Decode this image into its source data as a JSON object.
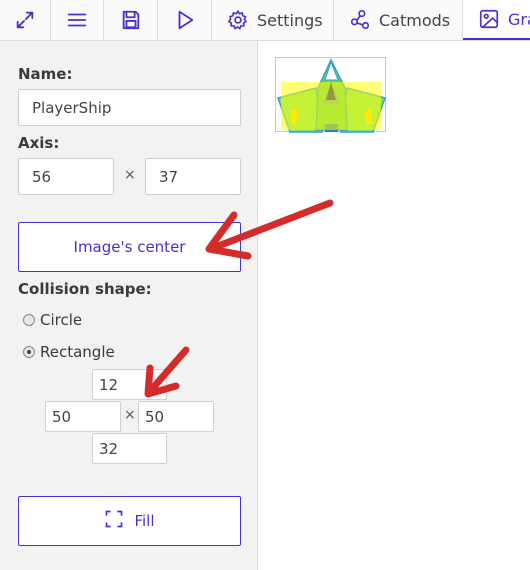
{
  "toolbar": {
    "buttons": [
      {
        "name": "expand",
        "icon": "expand-icon"
      },
      {
        "name": "menu",
        "icon": "menu-icon"
      },
      {
        "name": "save",
        "icon": "save-icon"
      },
      {
        "name": "play",
        "icon": "play-icon"
      }
    ],
    "tabs": [
      {
        "label": "Settings",
        "icon": "gear-icon"
      },
      {
        "label": "Catmods",
        "icon": "share-icon"
      },
      {
        "label": "Gra",
        "icon": "image-icon",
        "active": true
      }
    ]
  },
  "sidebar": {
    "name_label": "Name:",
    "name_value": "PlayerShip",
    "axis_label": "Axis:",
    "axis_x": "56",
    "axis_y": "37",
    "times": "×",
    "center_button": "Image's center",
    "collision_label": "Collision shape:",
    "shapes": [
      {
        "label": "Circle",
        "checked": false
      },
      {
        "label": "Rectangle",
        "checked": true
      }
    ],
    "rect": {
      "top": "12",
      "left": "50",
      "right": "50",
      "bottom": "32"
    },
    "fill_button": "Fill"
  },
  "colors": {
    "accent": "#4b2fd0",
    "arrow": "#d42b2b",
    "toolbar_bg": "#fafafa",
    "sidebar_bg": "#f2f2f2",
    "collision_overlay": "#ffff00"
  }
}
